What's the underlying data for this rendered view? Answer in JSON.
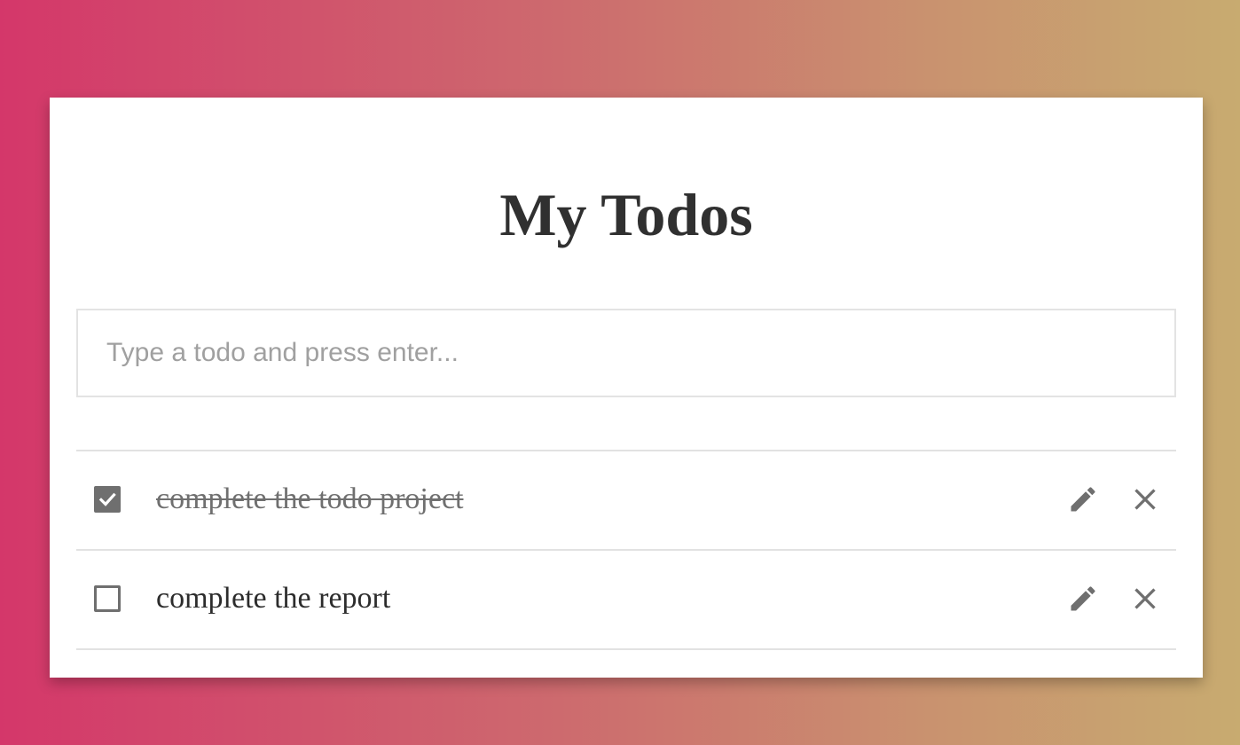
{
  "app": {
    "title": "My Todos"
  },
  "input": {
    "placeholder": "Type a todo and press enter...",
    "value": ""
  },
  "todos": [
    {
      "text": "complete the todo project",
      "completed": true,
      "edit_icon": "pencil-icon",
      "delete_icon": "close-icon"
    },
    {
      "text": "complete the report",
      "completed": false,
      "edit_icon": "pencil-icon",
      "delete_icon": "close-icon"
    }
  ],
  "colors": {
    "gradient_start": "#d4376a",
    "gradient_end": "#c8ab70",
    "icon_gray": "#6f6f6f",
    "text_dark": "#2c2c2c"
  }
}
